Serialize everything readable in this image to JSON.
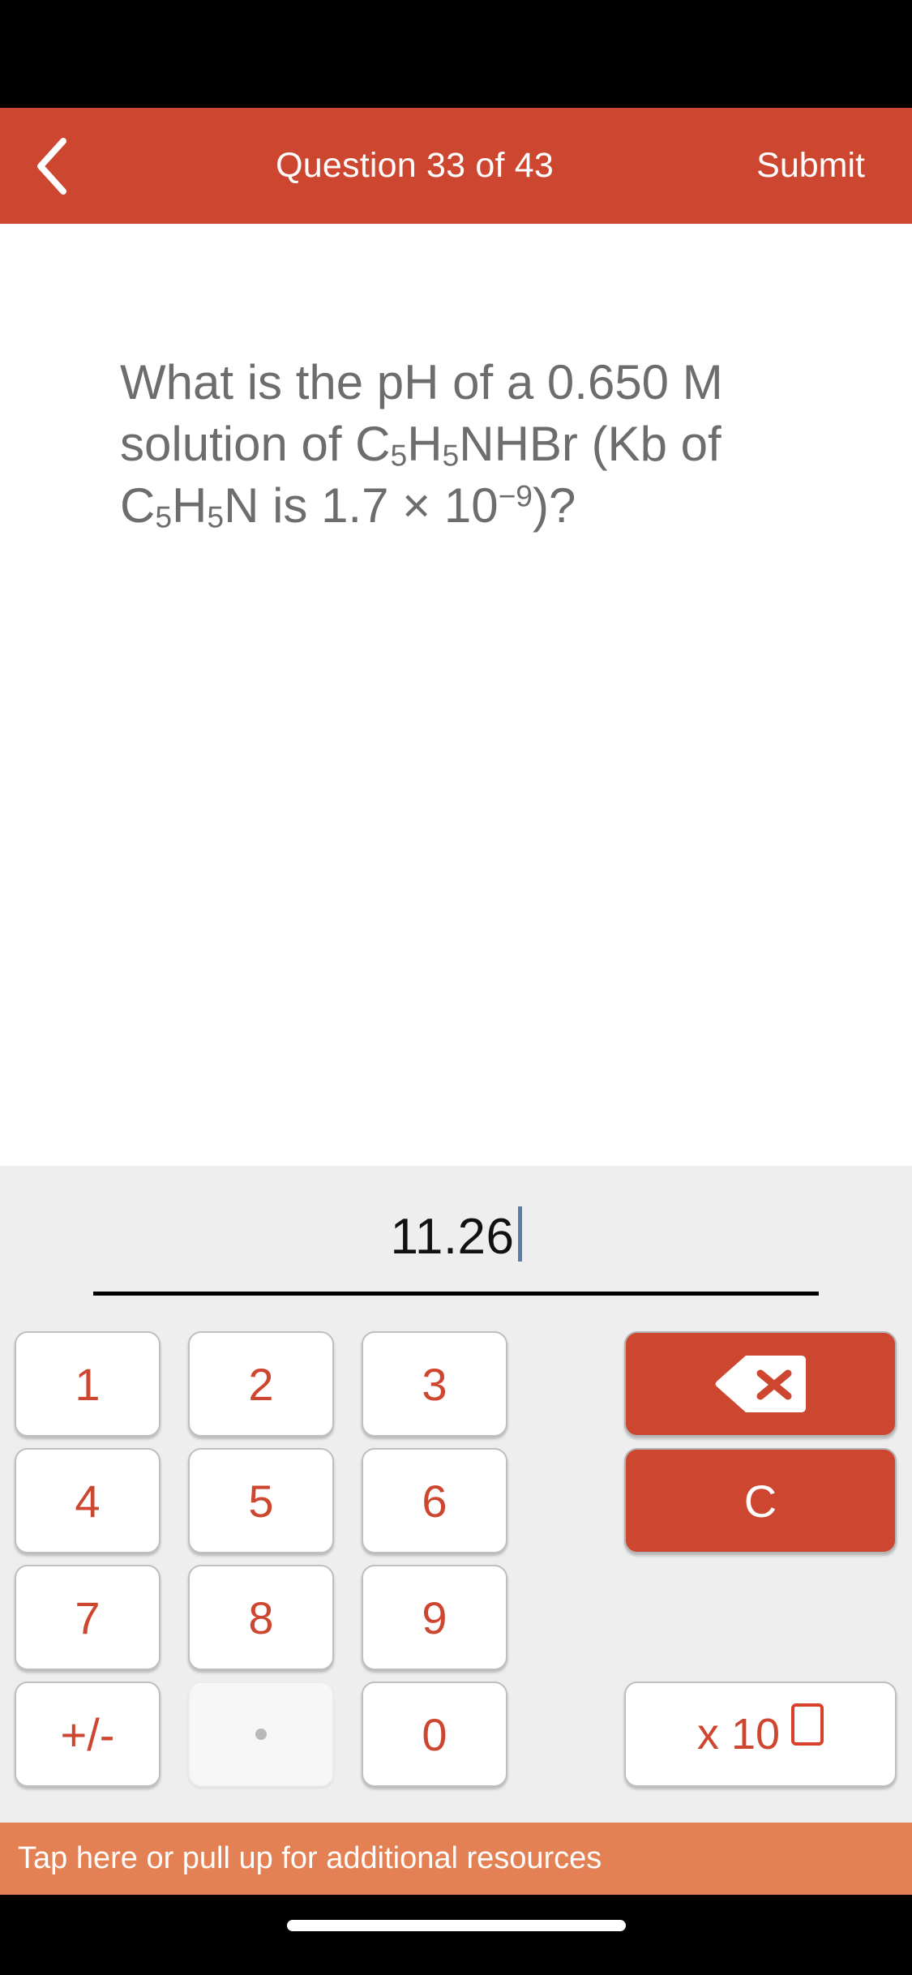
{
  "colors": {
    "header_red": "#cd4630",
    "banner_orange": "#e38155",
    "keypad_bg": "#eeeeee",
    "key_text_red": "#cd4630",
    "question_text": "#6d6d6d",
    "caret_blue": "#5b7ea8"
  },
  "header": {
    "back_icon": "chevron-left-icon",
    "title": "Question 33 of 43",
    "question_number": 33,
    "question_total": 43,
    "submit_label": "Submit"
  },
  "question": {
    "text_plain": "What is the pH of a 0.650 M solution of C5H5NHBr (Kb of C5H5N is 1.7 x 10-9)?",
    "part1": "What is the pH of a 0.650 M solution of C",
    "sub1": "5",
    "part2": "H",
    "sub2": "5",
    "part3": "NHBr (Kb of C",
    "sub3": "5",
    "part4": "H",
    "sub4": "5",
    "part5": "N is 1.7 × 10",
    "sup1": "−9",
    "part6": ")?"
  },
  "answer": {
    "value": "11.26",
    "placeholder": "",
    "caret_visible": true
  },
  "keypad": {
    "keys": [
      {
        "label": "1",
        "name": "key-1",
        "type": "digit",
        "disabled": false
      },
      {
        "label": "2",
        "name": "key-2",
        "type": "digit",
        "disabled": false
      },
      {
        "label": "3",
        "name": "key-3",
        "type": "digit",
        "disabled": false
      },
      {
        "label": "4",
        "name": "key-4",
        "type": "digit",
        "disabled": false
      },
      {
        "label": "5",
        "name": "key-5",
        "type": "digit",
        "disabled": false
      },
      {
        "label": "6",
        "name": "key-6",
        "type": "digit",
        "disabled": false
      },
      {
        "label": "7",
        "name": "key-7",
        "type": "digit",
        "disabled": false
      },
      {
        "label": "8",
        "name": "key-8",
        "type": "digit",
        "disabled": false
      },
      {
        "label": "9",
        "name": "key-9",
        "type": "digit",
        "disabled": false
      },
      {
        "label": "+/-",
        "name": "key-sign",
        "type": "sign",
        "disabled": false
      },
      {
        "label": ".",
        "name": "key-decimal",
        "type": "decimal",
        "disabled": true
      },
      {
        "label": "0",
        "name": "key-0",
        "type": "digit",
        "disabled": false
      }
    ],
    "backspace": {
      "icon": "backspace-icon",
      "label": ""
    },
    "clear": {
      "label": "C"
    },
    "exponent": {
      "label": "x 10",
      "box": "□"
    }
  },
  "banner": {
    "text": "Tap here or pull up for additional resources"
  }
}
